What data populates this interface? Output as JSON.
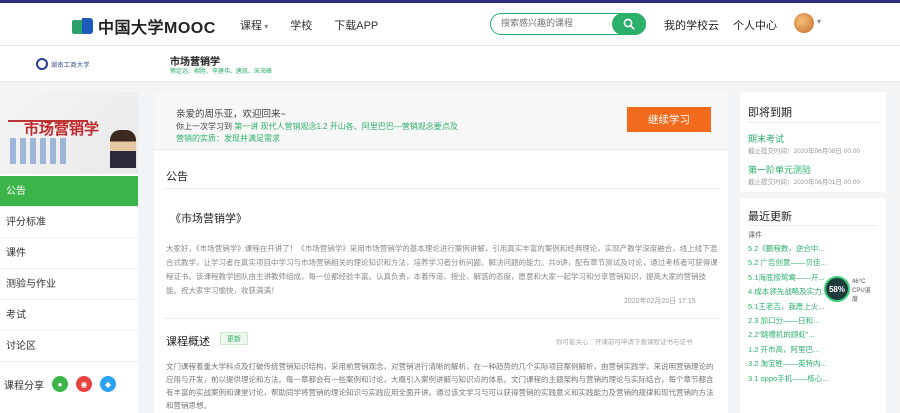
{
  "header": {
    "logo_text": "中国大学MOOC",
    "nav": [
      "课程",
      "学校",
      "下载APP"
    ],
    "search_placeholder": "搜索感兴趣的课程",
    "links": [
      "我的学校云",
      "个人中心"
    ]
  },
  "course": {
    "university": "湖南工商大学",
    "title": "市场营销学",
    "teachers": "蔡定远、柳胜、李建伟、唐凯、宋海峰"
  },
  "sidebar": {
    "cover_text": "市场营销学",
    "menu": [
      "公告",
      "评分标准",
      "课件",
      "测验与作业",
      "考试",
      "讨论区"
    ],
    "share_label": "课程分享"
  },
  "main": {
    "welcome_line": "亲爱的周乐亚，欢迎回来~",
    "last_study_prefix": "你上一次学习到",
    "last_study_link": "第一讲 现代人营销观念1.2 开山各、阿里巴巴—营销观念要点及",
    "last_study_line2": "营销的实质：发现并满足需求",
    "continue_btn": "继续学习",
    "section_title": "公告",
    "ann_title": "《市场营销学》",
    "ann_body": "大家好，《市场营销学》课程在开讲了！《市场营销学》采用市场营销学的基本理论进行案例讲解，引用真实丰富的案例和经典理论，实现产教学深度融合，线上线下混合式教学，让学习者在真实项目中学习与市场营销相关的理论知识和方法，培养学习者分析问题、解决问题的能力。共9讲，配有章节测试及讨论，通过考核者可获得课程证书。该课程教学团队由主讲教师组成，每一位都经验丰富。认真负责，本着传道、授业、解惑的态度，愿意和大家一起学习和分享营销知识，提高大家的营销技能。祝大家学习愉快，收获满满！",
    "ann_date": "2020年02月20日 17:15",
    "overview_title": "课程概述",
    "overview_badge": "更新",
    "overview_note": "你可能关心：开课前可申请下载课程证书与证书",
    "overview_body": "文门课程着重大学科点及打破传统营销知识结构，采用前营销观念，对营销进行清晰的解析，在一种趋势的几个实际项目案例解析，由营销实践学，来说明营销理论的应用与开发，前以提供理论和方法。每一章都会有一些案例和讨论，大概引入案例讲解与知识点的体系。文门课程的主题架构与营销的理论与实际结合，每个章节都含有丰富的实战案例和课堂讨论，帮助同学将营销的理论知识与实践应用全面开讲。通过该文学习与可以获得营销的实践意义和实践能力及营销的规律和现代营销的方法和营销思想。"
  },
  "right": {
    "due_title": "即将到期",
    "due_items": [
      {
        "title": "期末考试",
        "date": "截止提交时间：2020年06月08日 00:00"
      },
      {
        "title": "第一阶单元测验",
        "date": "截止提交时间：2020年06月01日 00:00"
      }
    ],
    "updates_title": "最近更新",
    "updates_cat": "课件",
    "updates": [
      "5.2《鹏程数，逆合中...",
      "5.2 广告创意——贝佳...",
      "5.1海底捞鸳鸯——开...",
      "4.成本领先战略及实力...",
      "5.1王老吉，我愿上火...",
      "2.3 加口分——日和...",
      "2.2“跳槽机的顾虹”...",
      "1.2 开市高，阿里巴...",
      "3.2 淘宝胜——英特内...",
      "3.1 oppo手机——核心..."
    ]
  },
  "widget": {
    "percent": "58%",
    "temp": "46°C",
    "label": "CPU温度"
  }
}
